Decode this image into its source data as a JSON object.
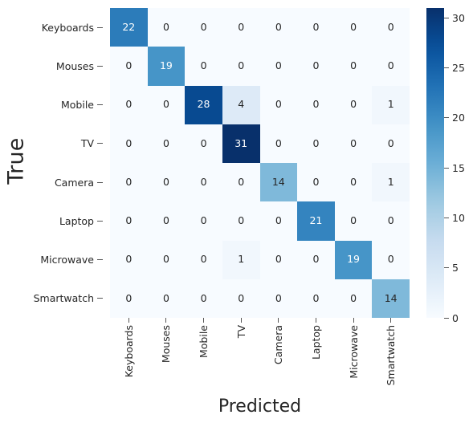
{
  "chart_data": {
    "type": "heatmap",
    "title": "",
    "xlabel": "Predicted",
    "ylabel": "True",
    "categories": [
      "Keyboards",
      "Mouses",
      "Mobile",
      "TV",
      "Camera",
      "Laptop",
      "Microwave",
      "Smartwatch"
    ],
    "x_tick_labels": [
      "Keyboards",
      "Mouses",
      "Mobile",
      "TV",
      "Camera",
      "Laptop",
      "Microwave",
      "Smartwatch"
    ],
    "y_tick_labels": [
      "Keyboards",
      "Mouses",
      "Mobile",
      "TV",
      "Camera",
      "Laptop",
      "Microwave",
      "Smartwatch"
    ],
    "rows": [
      {
        "label": "Keyboards",
        "values": [
          22,
          0,
          0,
          0,
          0,
          0,
          0,
          0
        ]
      },
      {
        "label": "Mouses",
        "values": [
          0,
          19,
          0,
          0,
          0,
          0,
          0,
          0
        ]
      },
      {
        "label": "Mobile",
        "values": [
          0,
          0,
          28,
          4,
          0,
          0,
          0,
          1
        ]
      },
      {
        "label": "TV",
        "values": [
          0,
          0,
          0,
          31,
          0,
          0,
          0,
          0
        ]
      },
      {
        "label": "Camera",
        "values": [
          0,
          0,
          0,
          0,
          14,
          0,
          0,
          1
        ]
      },
      {
        "label": "Laptop",
        "values": [
          0,
          0,
          0,
          0,
          0,
          21,
          0,
          0
        ]
      },
      {
        "label": "Microwave",
        "values": [
          0,
          0,
          0,
          1,
          0,
          0,
          19,
          0
        ]
      },
      {
        "label": "Smartwatch",
        "values": [
          0,
          0,
          0,
          0,
          0,
          0,
          0,
          14
        ]
      }
    ],
    "values": [
      [
        22,
        0,
        0,
        0,
        0,
        0,
        0,
        0
      ],
      [
        0,
        19,
        0,
        0,
        0,
        0,
        0,
        0
      ],
      [
        0,
        0,
        28,
        4,
        0,
        0,
        0,
        1
      ],
      [
        0,
        0,
        0,
        31,
        0,
        0,
        0,
        0
      ],
      [
        0,
        0,
        0,
        0,
        14,
        0,
        0,
        1
      ],
      [
        0,
        0,
        0,
        0,
        0,
        21,
        0,
        0
      ],
      [
        0,
        0,
        0,
        1,
        0,
        0,
        19,
        0
      ],
      [
        0,
        0,
        0,
        0,
        0,
        0,
        0,
        14
      ]
    ],
    "annotated": true,
    "grid": false,
    "colormap": "Blues",
    "vmin": 0,
    "vmax": 31,
    "colorbar": {
      "position": "right",
      "ticks": [
        0,
        5,
        10,
        15,
        20,
        25,
        30
      ],
      "tick_labels": [
        "0",
        "5",
        "10",
        "15",
        "20",
        "25",
        "30"
      ],
      "range": [
        0,
        31
      ]
    },
    "colors": {
      "cmap_low": "#f7fbff",
      "cmap_high": "#08306b",
      "text_dark": "#262626",
      "text_light": "#ffffff",
      "background": "#ffffff"
    }
  }
}
